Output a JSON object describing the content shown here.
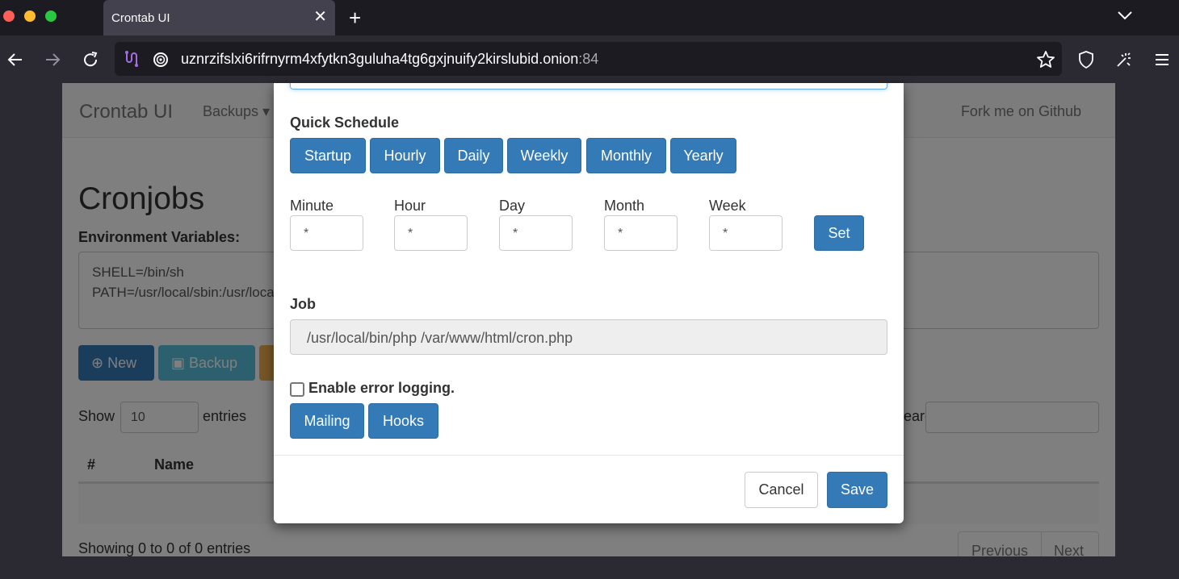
{
  "browser": {
    "tab_title": "Crontab UI",
    "tab_close": "✕",
    "new_tab": "+",
    "url_host": "uznrzifslxi6rifrnyrm4xfytkn3guluha4tg6gxjnuify2kirslubid.onion",
    "url_port": ":84",
    "icons": [
      "back-icon",
      "forward-icon",
      "reload-icon",
      "onion-circuit-icon",
      "onion-icon",
      "bookmark-star-icon",
      "shield-icon",
      "extensions-icon",
      "menu-icon",
      "tabs-dropdown-icon"
    ]
  },
  "page": {
    "brand": "Crontab UI",
    "backups_menu": "Backups ▾",
    "fork": "Fork me on Github",
    "heading": "Cronjobs",
    "env_label": "Environment Variables:",
    "env_value": "SHELL=/bin/sh\nPATH=/usr/local/sbin:/usr/local/bin:/usr/sbin:/usr/bin:/sbin:/bin",
    "new_button": "New",
    "backup_button": "Backup",
    "show_label": "Show",
    "entries_value": "10",
    "entries_label": "entries",
    "search_label": "Search:",
    "col_index": "#",
    "col_name": "Name",
    "showing": "Showing 0 to 0 of 0 entries",
    "previous": "Previous",
    "next": "Next"
  },
  "modal": {
    "quick_schedule_label": "Quick Schedule",
    "quick_buttons": [
      "Startup",
      "Hourly",
      "Daily",
      "Weekly",
      "Monthly",
      "Yearly"
    ],
    "fields": {
      "minute": {
        "label": "Minute",
        "value": "*"
      },
      "hour": {
        "label": "Hour",
        "value": "*"
      },
      "day": {
        "label": "Day",
        "value": "*"
      },
      "month": {
        "label": "Month",
        "value": "*"
      },
      "week": {
        "label": "Week",
        "value": "*"
      }
    },
    "set_button": "Set",
    "job_label": "Job",
    "job_value": "/usr/local/bin/php /var/www/html/cron.php",
    "error_logging_label": "Enable error logging.",
    "error_logging_checked": false,
    "mailing_button": "Mailing",
    "hooks_button": "Hooks",
    "cancel_button": "Cancel",
    "save_button": "Save"
  },
  "colors": {
    "primary": "#337ab7",
    "info": "#5bc0de",
    "warning": "#f0ad4e",
    "chrome_dark": "#1c1b22"
  }
}
